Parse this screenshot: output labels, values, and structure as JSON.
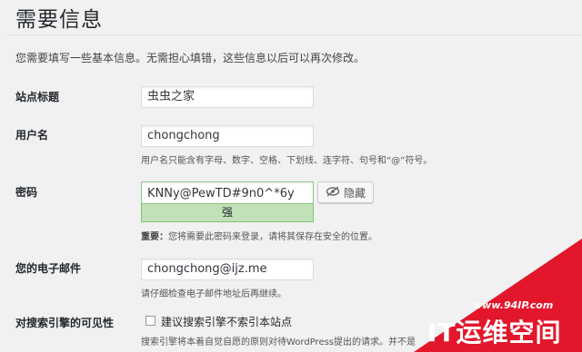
{
  "page": {
    "title": "需要信息",
    "intro": "您需要填写一些基本信息。无需担心填错，这些信息以后可以再次修改。"
  },
  "site_title": {
    "label": "站点标题",
    "value": "虫虫之家"
  },
  "username": {
    "label": "用户名",
    "value": "chongchong",
    "hint": "用户名只能含有字母、数字、空格、下划线、连字符、句号和“@”符号。"
  },
  "password": {
    "label": "密码",
    "value": "KNNy@PewTD#9n0^*6y",
    "strength": "强",
    "hide_label": "隐藏",
    "note_prefix": "重要：",
    "note": "您将需要此密码来登录，请将其保存在安全的位置。"
  },
  "email": {
    "label": "您的电子邮件",
    "value": "chongchong@ijz.me",
    "hint": "请仔细检查电子邮件地址后再继续。"
  },
  "seo": {
    "label": "对搜索引擎的可见性",
    "checkbox_label": "建议搜索引擎不索引本站点",
    "hint": "搜索引擎将本着自觉自愿的原则对待WordPress提出的请求。并不是"
  },
  "watermark": {
    "url": "www.94IP.com",
    "brand": "IT运维空间",
    "color": "#e2172b"
  }
}
